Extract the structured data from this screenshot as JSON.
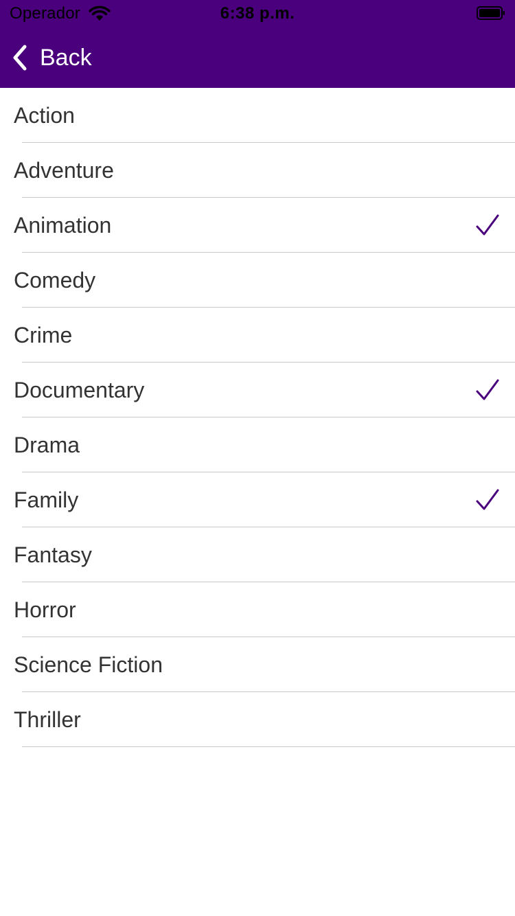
{
  "status_bar": {
    "carrier": "Operador",
    "time": "6:38 p.m.",
    "wifi_icon": "wifi-icon",
    "battery_icon": "battery-icon"
  },
  "nav_bar": {
    "back_label": "Back",
    "back_icon": "chevron-left-icon",
    "background_color": "#4a007c"
  },
  "genres": {
    "items": [
      {
        "label": "Action",
        "selected": false
      },
      {
        "label": "Adventure",
        "selected": false
      },
      {
        "label": "Animation",
        "selected": true
      },
      {
        "label": "Comedy",
        "selected": false
      },
      {
        "label": "Crime",
        "selected": false
      },
      {
        "label": "Documentary",
        "selected": true
      },
      {
        "label": "Drama",
        "selected": false
      },
      {
        "label": "Family",
        "selected": true
      },
      {
        "label": "Fantasy",
        "selected": false
      },
      {
        "label": "Horror",
        "selected": false
      },
      {
        "label": "Science Fiction",
        "selected": false
      },
      {
        "label": "Thriller",
        "selected": false
      }
    ],
    "check_icon": "checkmark-icon",
    "check_color": "#4a007c"
  }
}
